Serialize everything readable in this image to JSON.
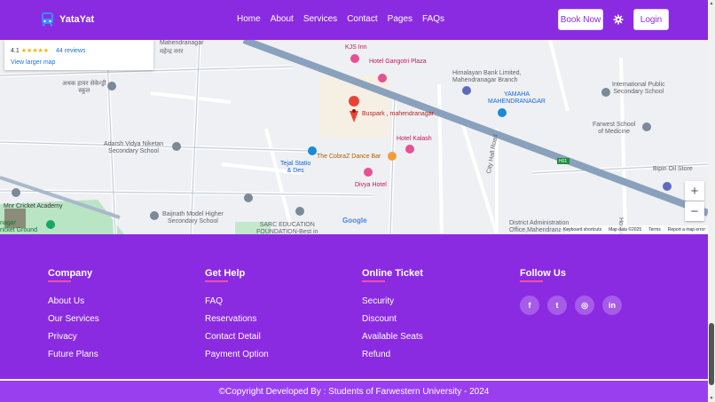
{
  "brand": {
    "name": "YataYat"
  },
  "nav": {
    "items": [
      "Home",
      "About",
      "Services",
      "Contact",
      "Pages",
      "FAQs"
    ]
  },
  "actions": {
    "book_now": "Book Now",
    "login": "Login"
  },
  "map": {
    "rating": "4.1",
    "stars": "★★★★★",
    "reviews": "44 reviews",
    "view_larger": "View larger map",
    "place_name": "Buspark , mahendranagar",
    "labels": {
      "kjs_inn": "KJS Inn",
      "hotel_gangotri": "Hotel Gangotri Plaza",
      "himalayan_bank": "Himalayan Bank Limited,\nMahendranagar Branch",
      "yamaha": "YAMAHA\nMAHENDRANAGAR",
      "international_school": "International Public\nSecondary School",
      "farwest_medicine": "Farwest School\nof Medicine",
      "hotel_kalash": "Hotel Kalash",
      "cobraz": "The CobraZ Dance Bar",
      "divya_hotel": "Divya Hotel",
      "tejal_station": "Tejal Statio\n& Des",
      "adarsh_school": "Adarsh Vidya Niketan\nSecondary School",
      "mnr_cricket": "Mnr Cricket Academy",
      "cricket_ground": "nagar\nricket Ground",
      "baijnath_school": "Baijnath Model Higher\nSecondary School",
      "sarc_education": "SARC EDUCATION\nFOUNDATION-Best in",
      "district_admin": "District Administration\nOffice,Mahendranagar",
      "bipin_oil": "Bipin Oil Store",
      "city_hall_road": "City Hall Road",
      "hospital_lane": "Hospital Li",
      "mahendranagar_top": "Mahendranagar",
      "nepali_top": "महेन्द्र नगर",
      "nepali_school": "अथक हायर सेकेन्ड्री\nस्कूल",
      "road_code": "H01"
    },
    "footer": [
      "Keyboard shortcuts",
      "Map data ©2025",
      "Terms",
      "Report a map error"
    ],
    "zoom_in": "+",
    "zoom_out": "−",
    "google": "Google"
  },
  "footer": {
    "columns": [
      {
        "title": "Company",
        "links": [
          "About Us",
          "Our Services",
          "Privacy",
          "Future Plans"
        ]
      },
      {
        "title": "Get Help",
        "links": [
          "FAQ",
          "Reservations",
          "Contact Detail",
          "Payment Option"
        ]
      },
      {
        "title": "Online Ticket",
        "links": [
          "Security",
          "Discount",
          "Available Seats",
          "Refund"
        ]
      }
    ],
    "follow_title": "Follow Us",
    "socials": [
      "f",
      "t",
      "◎",
      "in"
    ],
    "copyright": "©Copyright Developed By : Students of Farwestern University - 2024"
  },
  "colors": {
    "primary": "#8a2be2",
    "accent": "#ff4da6"
  }
}
